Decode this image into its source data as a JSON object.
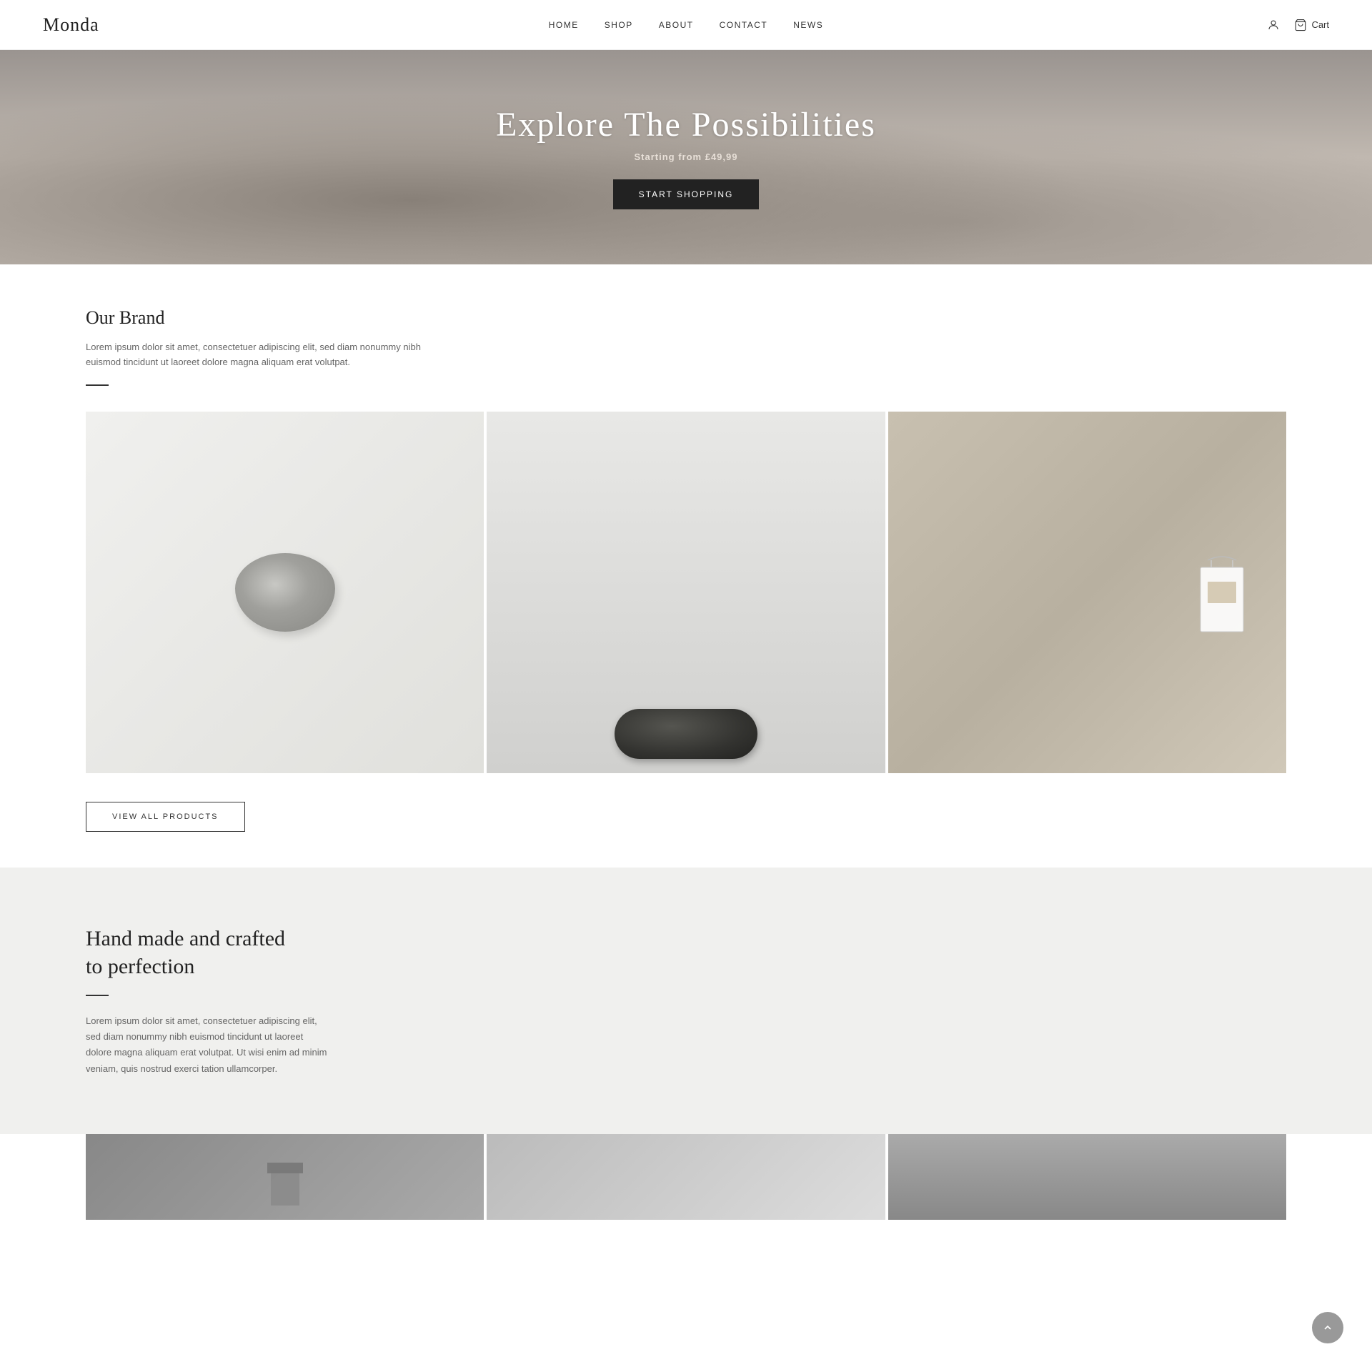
{
  "brand": {
    "logo": "Monda"
  },
  "nav": {
    "items": [
      {
        "label": "HOME",
        "id": "home"
      },
      {
        "label": "SHOP",
        "id": "shop"
      },
      {
        "label": "ABOUT",
        "id": "about"
      },
      {
        "label": "CONTACT",
        "id": "contact"
      },
      {
        "label": "NEWS",
        "id": "news"
      }
    ]
  },
  "header_icons": {
    "account_label": "",
    "cart_label": "Cart"
  },
  "hero": {
    "title": "Explore The Possibilities",
    "subtitle": "Starting from £49,99",
    "cta_button": "START SHOPPING"
  },
  "brand_section": {
    "title": "Our Brand",
    "description": "Lorem ipsum dolor sit amet, consectetuer adipiscing elit, sed diam nonummy nibh euismod tincidunt ut laoreet dolore magna aliquam erat volutpat.",
    "view_all_button": "VIEW ALL PRODUCTS"
  },
  "crafted_section": {
    "title": "Hand made and crafted to perfection",
    "description": "Lorem ipsum dolor sit amet, consectetuer adipiscing elit, sed diam nonummy nibh euismod tincidunt ut laoreet dolore magna aliquam erat volutpat. Ut wisi enim ad minim veniam, quis nostrud exerci tation ullamcorper."
  },
  "scroll_top": {
    "label": "↑"
  }
}
